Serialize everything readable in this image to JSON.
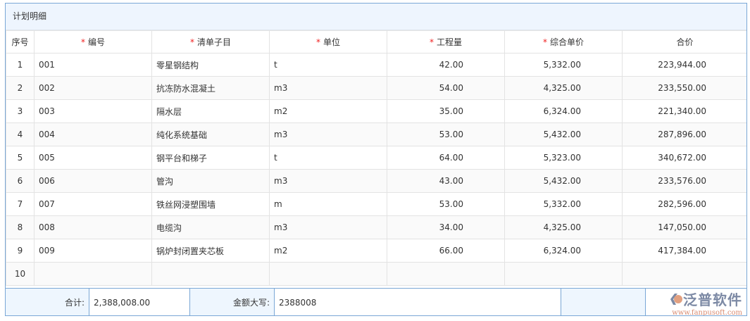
{
  "panel": {
    "title": "计划明细"
  },
  "columns": [
    {
      "label": "序号",
      "required": false
    },
    {
      "label": "编号",
      "required": true
    },
    {
      "label": "清单子目",
      "required": true
    },
    {
      "label": "单位",
      "required": true
    },
    {
      "label": "工程量",
      "required": true
    },
    {
      "label": "综合单价",
      "required": true
    },
    {
      "label": "合价",
      "required": false
    }
  ],
  "rows": [
    [
      "1",
      "001",
      "零星钢结构",
      "t",
      "42.00",
      "5,332.00",
      "223,944.00"
    ],
    [
      "2",
      "002",
      "抗冻防水混凝土",
      "m3",
      "54.00",
      "4,325.00",
      "233,550.00"
    ],
    [
      "3",
      "003",
      "隔水层",
      "m2",
      "35.00",
      "6,324.00",
      "221,340.00"
    ],
    [
      "4",
      "004",
      "纯化系统基础",
      "m3",
      "53.00",
      "5,432.00",
      "287,896.00"
    ],
    [
      "5",
      "005",
      "钢平台和梯子",
      "t",
      "64.00",
      "5,323.00",
      "340,672.00"
    ],
    [
      "6",
      "006",
      "管沟",
      "m3",
      "43.00",
      "5,432.00",
      "233,576.00"
    ],
    [
      "7",
      "007",
      "铁丝网浸塑围墙",
      "m",
      "53.00",
      "5,332.00",
      "282,596.00"
    ],
    [
      "8",
      "008",
      "电缆沟",
      "m3",
      "34.00",
      "4,325.00",
      "147,050.00"
    ],
    [
      "9",
      "009",
      "锅炉封闭置夹芯板",
      "m2",
      "66.00",
      "6,324.00",
      "417,384.00"
    ],
    [
      "10",
      "",
      "",
      "",
      "",
      "",
      ""
    ]
  ],
  "footer": {
    "total_label": "合计:",
    "total_value": "2,388,008.00",
    "uppercase_label": "金额大写:",
    "uppercase_value": "2388008"
  },
  "logo": {
    "name": "泛普软件",
    "url": "www.fanpusoft.com"
  }
}
